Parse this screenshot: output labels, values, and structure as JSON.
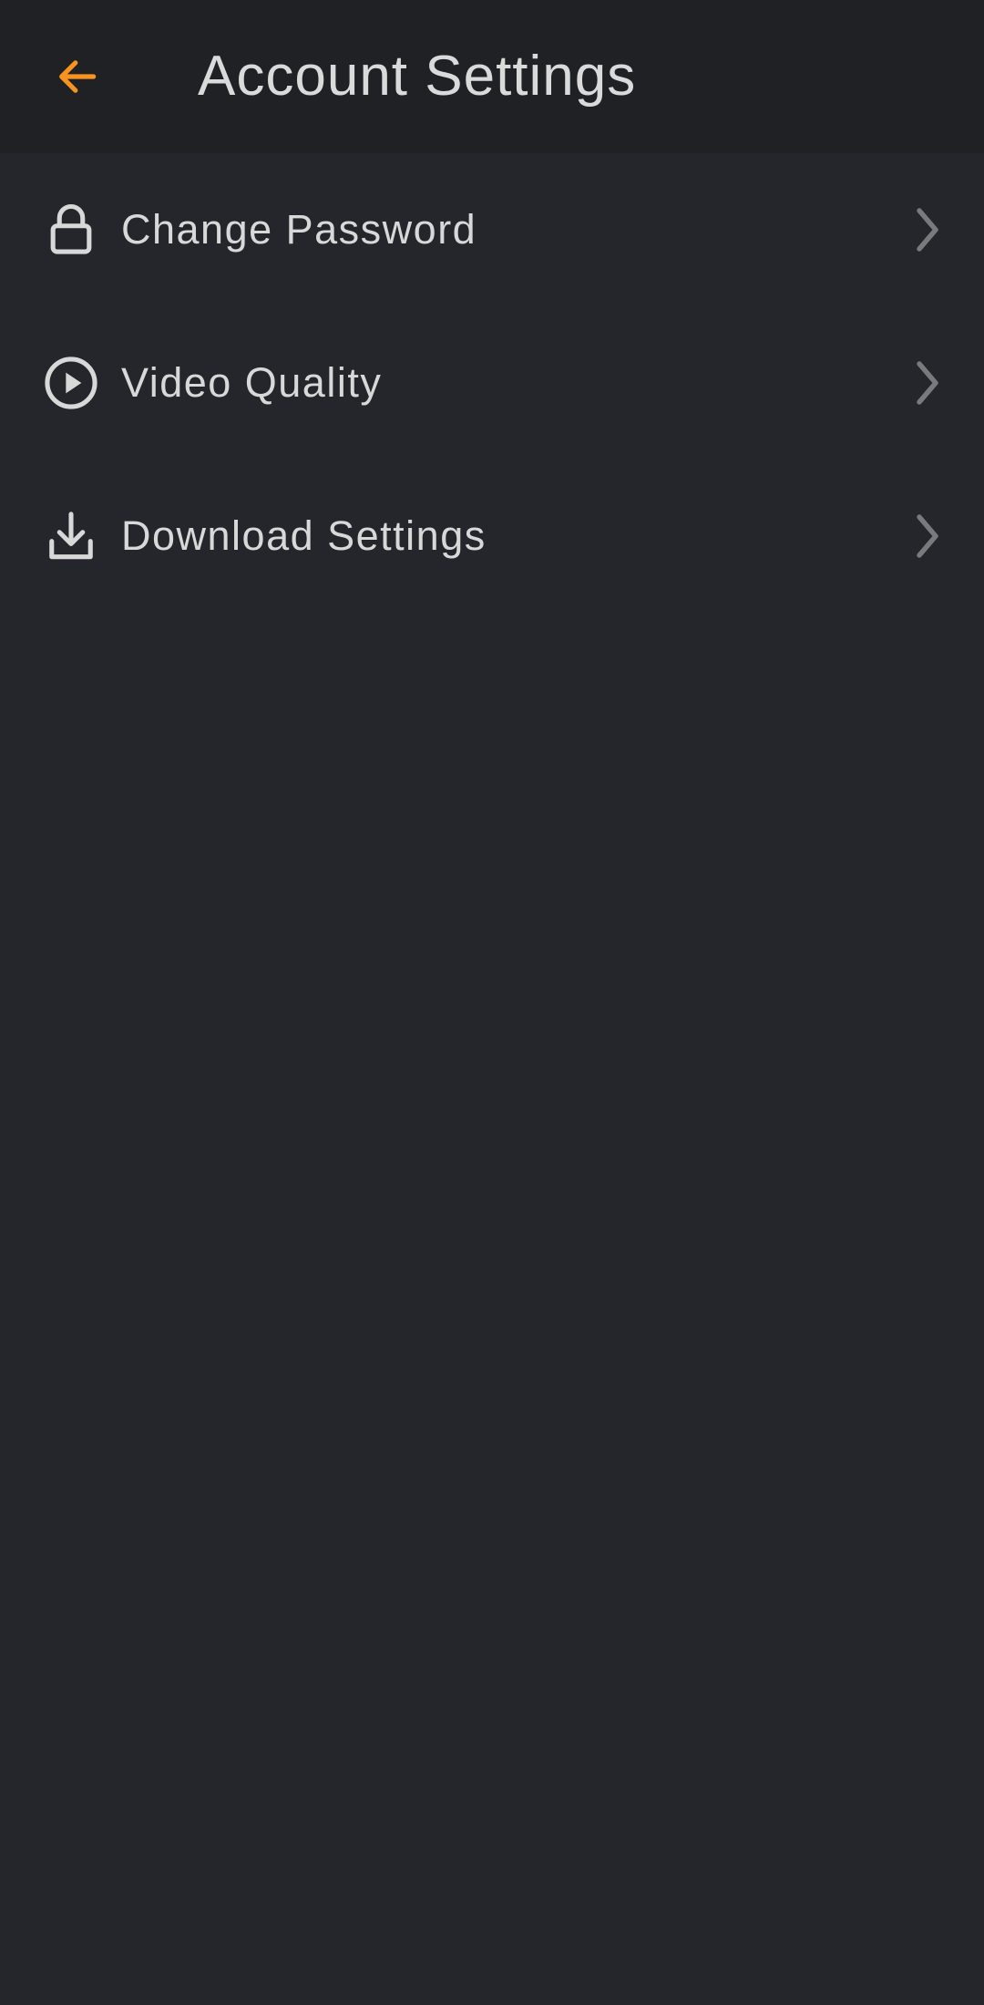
{
  "header": {
    "title": "Account Settings",
    "back_icon": "arrow-left-icon"
  },
  "settings": {
    "items": [
      {
        "label": "Change Password",
        "icon": "lock-icon"
      },
      {
        "label": "Video Quality",
        "icon": "play-circle-icon"
      },
      {
        "label": "Download Settings",
        "icon": "download-icon"
      }
    ]
  },
  "colors": {
    "background": "#25262b",
    "app_bar": "#202124",
    "accent": "#f7931e",
    "text": "#d8d8d8",
    "chevron": "#7a7a7e"
  }
}
